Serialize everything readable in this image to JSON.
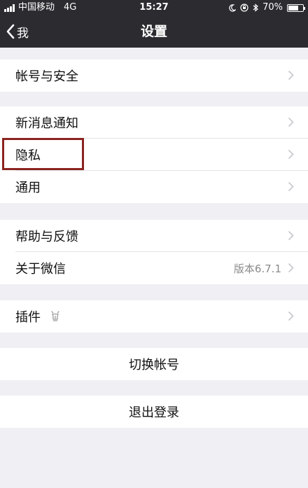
{
  "status_bar": {
    "carrier": "中国移动",
    "network": "4G",
    "time": "15:27",
    "battery": "70%",
    "battery_level": 0.7
  },
  "nav": {
    "back_label": "我",
    "title": "设置"
  },
  "groups": {
    "account": {
      "label": "帐号与安全"
    },
    "notify": {
      "items": [
        "新消息通知",
        "隐私",
        "通用"
      ]
    },
    "help": {
      "feedback": "帮助与反馈",
      "about": "关于微信",
      "version": "版本6.7.1"
    },
    "plugins": {
      "label": "插件"
    },
    "switch_account": "切换帐号",
    "logout": "退出登录"
  },
  "colors": {
    "nav_bg": "#2b2b30",
    "page_bg": "#efeff4",
    "highlight_border": "#8b2320"
  }
}
